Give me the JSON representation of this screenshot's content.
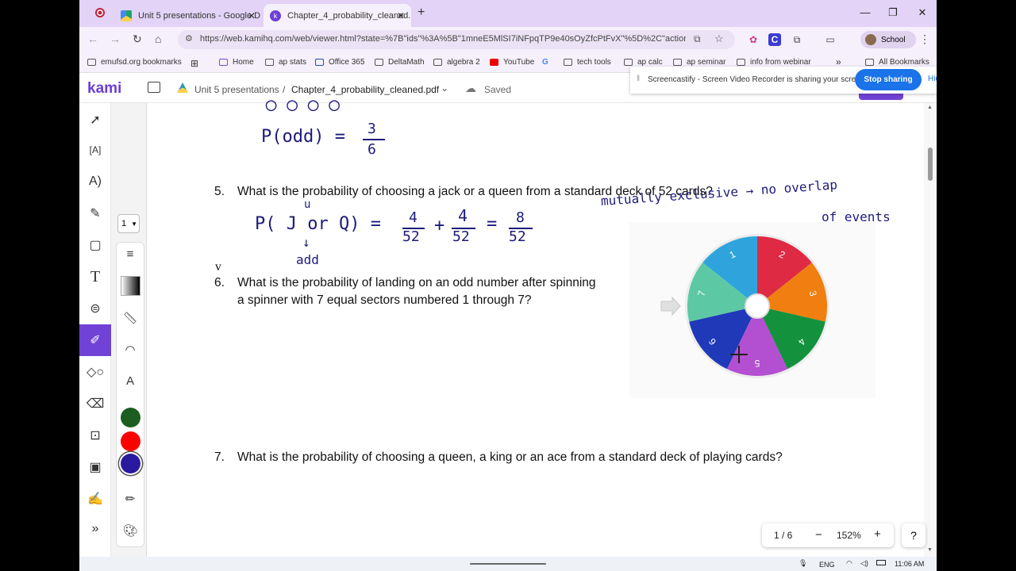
{
  "browser": {
    "tabs": [
      {
        "title": "Unit 5 presentations - Google D",
        "active": false
      },
      {
        "title": "Chapter_4_probability_cleaned.",
        "active": true
      }
    ],
    "new_tab": "+",
    "window_controls": {
      "minimize": "—",
      "maximize": "❐",
      "close": "✕"
    },
    "url": "https://web.kamihq.com/web/viewer.html?state=%7B\"ids\"%3A%5B\"1mneE5MlSI7iNFpqTP9e40sOyZfcPtFvX\"%5D%2C\"action...",
    "profile_label": "School",
    "bookmarks": [
      "emufsd.org bookmarks",
      "Home",
      "ap stats",
      "Office 365",
      "DeltaMath",
      "algebra 2",
      "YouTube",
      "tech tools",
      "ap calc",
      "ap seminar",
      "info from webinar",
      "All Bookmarks"
    ],
    "bookmarks_overflow": "»"
  },
  "kami": {
    "logo": "kami",
    "breadcrumb_folder": "Unit 5 presentations",
    "breadcrumb_sep": "/",
    "file_name": "Chapter_4_probability_cleaned.pdf",
    "save_status": "Saved",
    "page_select": "1",
    "page_indicator": "1 / 6",
    "zoom_minus": "−",
    "zoom_level": "152%",
    "zoom_plus": "+",
    "help": "?"
  },
  "screencastify": {
    "message": "Screencastify - Screen Video Recorder is sharing your screen.",
    "stop_label": "Stop sharing",
    "hide_label": "Hide"
  },
  "document": {
    "q5_num": "5.",
    "q5_text": "What is the probability of choosing a jack or a queen from a standard deck of 52 cards?",
    "q6_num": "6.",
    "q6_line1": "What is the probability of landing on an odd number after spinning",
    "q6_line2": "a spinner with 7 equal sectors numbered 1 through 7?",
    "q7_num": "7.",
    "q7_text": "What is the probability of choosing a queen, a king or an ace from a standard deck of playing cards?",
    "stray_mark": "v",
    "handwriting": {
      "p_odd": "P(odd) =",
      "p_odd_num": "3",
      "p_odd_den": "6",
      "p_jq": "P( J or Q) =",
      "u_mark": "u",
      "add": "add",
      "f1_num": "4",
      "f1_den": "52",
      "plus": "+",
      "f2_num": "4",
      "f2_den": "52",
      "equals": "=",
      "f3_num": "8",
      "f3_den": "52",
      "mutually": "mutually exclusive → no overlap",
      "events": "of events"
    },
    "spinner": {
      "sectors": [
        {
          "label": "1",
          "color": "#2fa4dc"
        },
        {
          "label": "2",
          "color": "#de2a43"
        },
        {
          "label": "3",
          "color": "#f07e10"
        },
        {
          "label": "4",
          "color": "#14913d"
        },
        {
          "label": "5",
          "color": "#b34fd1"
        },
        {
          "label": "6",
          "color": "#1f39b8"
        },
        {
          "label": "7",
          "color": "#5dc9a4"
        }
      ]
    }
  },
  "taskbar": {
    "lang": "ENG",
    "time": "11:06 AM"
  }
}
